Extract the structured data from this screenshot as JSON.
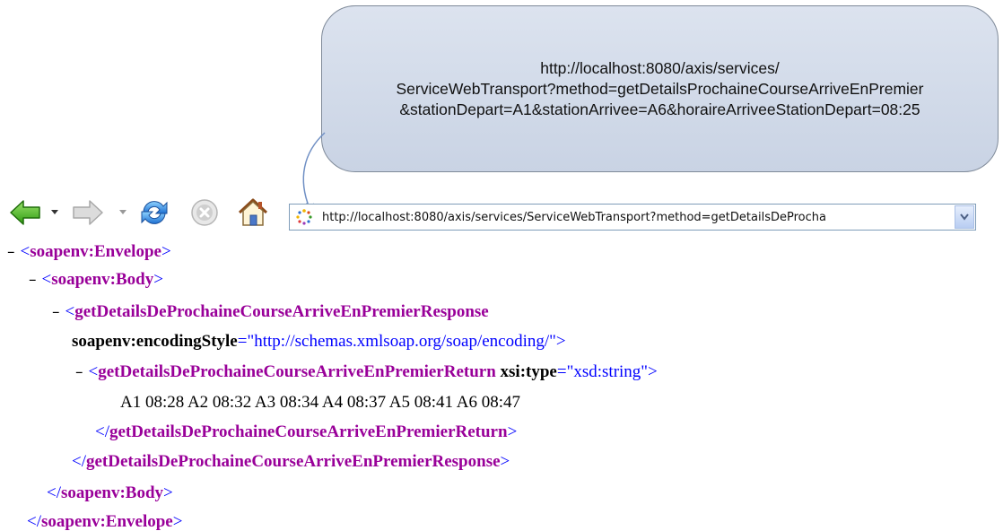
{
  "callout": {
    "line1": "http://localhost:8080/axis/services/",
    "line2": "ServiceWebTransport?method=getDetailsProchaineCourseArriveEnPremier",
    "line3": "&stationDepart=A1&stationArrivee=A6&horaireArriveeStationDepart=08:25"
  },
  "toolbar": {
    "back_icon": "back-arrow-icon",
    "forward_icon": "forward-arrow-icon",
    "refresh_icon": "refresh-icon",
    "stop_icon": "stop-icon",
    "home_icon": "home-icon",
    "address": "http://localhost:8080/axis/services/ServiceWebTransport?method=getDetailsDeProcha"
  },
  "xml": {
    "lines": [
      {
        "minus": "–",
        "open": "<",
        "tag": "soapenv:Envelope",
        "close": ">"
      },
      {
        "minus": "–",
        "open": "<",
        "tag": "soapenv:Body",
        "close": ">"
      },
      {
        "minus": "–",
        "open": "<",
        "tag": "getDetailsDeProchaineCourseArriveEnPremierResponse",
        "close": ""
      },
      {
        "attr": "soapenv:encodingStyle",
        "eq": "=\"",
        "value": "http://schemas.xmlsoap.org/soap/encoding/",
        "end": "\">"
      },
      {
        "minus": "–",
        "open": "<",
        "tag": "getDetailsDeProchaineCourseArriveEnPremierReturn",
        "attr": "xsi:type",
        "eq": "=\"",
        "value": "xsd:string",
        "end": "\">"
      },
      {
        "text": "A1 08:28 A2 08:32 A3 08:34 A4 08:37 A5 08:41 A6 08:47"
      },
      {
        "open": "</",
        "tag": "getDetailsDeProchaineCourseArriveEnPremierReturn",
        "close": ">"
      },
      {
        "open": "</",
        "tag": "getDetailsDeProchaineCourseArriveEnPremierResponse",
        "close": ">"
      },
      {
        "open": "</",
        "tag": "soapenv:Body",
        "close": ">"
      },
      {
        "open": "</",
        "tag": "soapenv:Envelope",
        "close": ">"
      }
    ]
  }
}
